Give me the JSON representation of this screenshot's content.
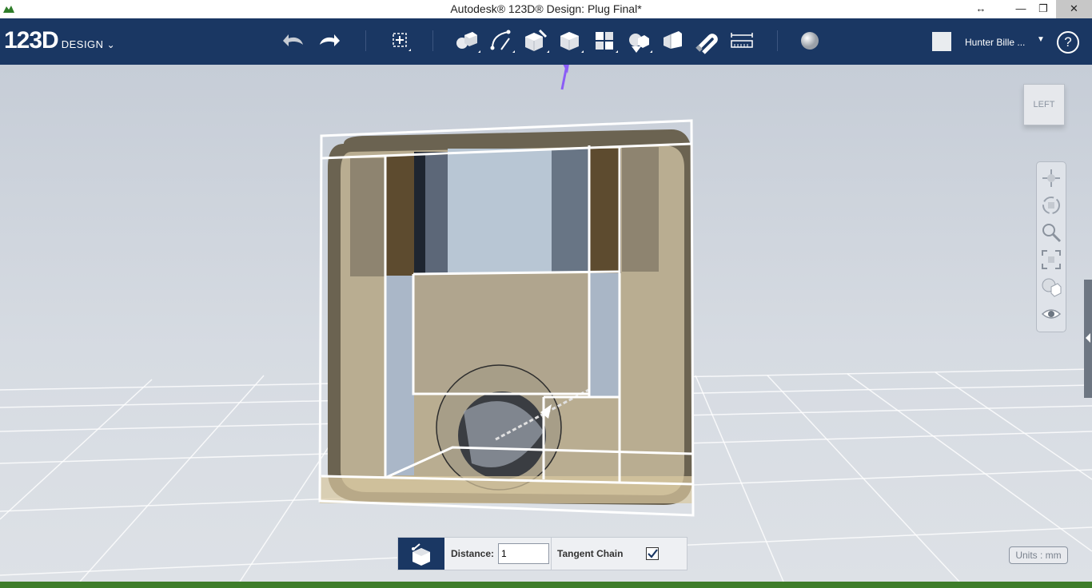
{
  "window": {
    "title": "Autodesk® 123D® Design: Plug Final*",
    "controls": [
      "↔",
      "—",
      "❐",
      "✕"
    ]
  },
  "toolbar": {
    "logo_big": "123D",
    "logo_small": "DESIGN",
    "logo_chevron": "⌄",
    "tools": [
      "undo-icon",
      "redo-icon",
      "transform-icon",
      "primitives-icon",
      "sketch-icon",
      "construct-icon",
      "modify-icon",
      "pattern-icon",
      "group-icon",
      "combine-icon",
      "snap-icon",
      "measure-icon",
      "material-icon"
    ],
    "user_name": "Hunter Bille ...",
    "help_label": "?"
  },
  "viewcube": {
    "face_label": "LEFT"
  },
  "nav_tools": [
    "pan-icon",
    "orbit-icon",
    "zoom-icon",
    "fit-icon",
    "visual-style-icon",
    "view-eye-icon"
  ],
  "bottom_panel": {
    "distance_label": "Distance:",
    "distance_value": "1",
    "tangent_label": "Tangent Chain",
    "tangent_checked": true
  },
  "units_label": "Units : mm",
  "colors": {
    "toolbar_bg": "#1a3763",
    "model_fill": "#b9ad91",
    "highlight": "#8b5cf6"
  }
}
